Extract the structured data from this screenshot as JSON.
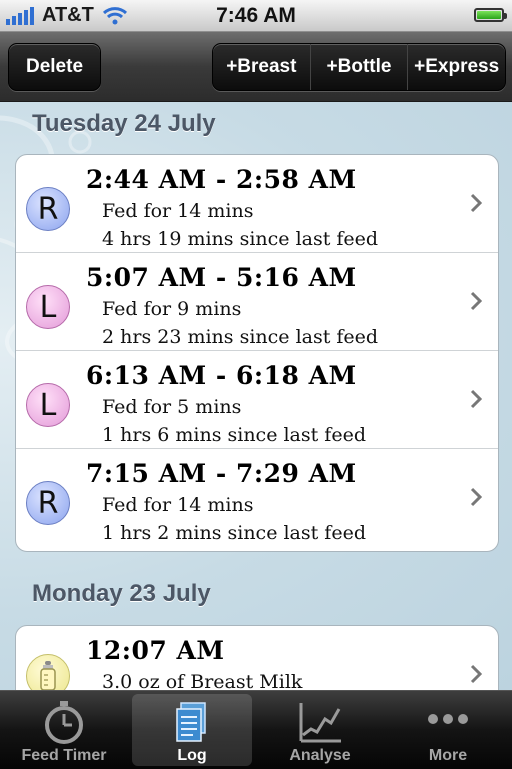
{
  "status": {
    "carrier": "AT&T",
    "time": "7:46 AM"
  },
  "toolbar": {
    "delete": "Delete",
    "add_breast": "+Breast",
    "add_bottle": "+Bottle",
    "add_express": "+Express"
  },
  "sections": [
    {
      "header": "Tuesday 24 July",
      "rows": [
        {
          "side": "R",
          "time": "2:44 AM - 2:58 AM",
          "line1": "Fed for 14 mins",
          "line2": "4 hrs 19 mins since last feed"
        },
        {
          "side": "L",
          "time": "5:07 AM - 5:16 AM",
          "line1": "Fed for 9 mins",
          "line2": "2 hrs 23 mins since last feed"
        },
        {
          "side": "L",
          "time": "6:13 AM - 6:18 AM",
          "line1": "Fed for 5 mins",
          "line2": "1 hrs 6 mins since last feed"
        },
        {
          "side": "R",
          "time": "7:15 AM - 7:29 AM",
          "line1": "Fed for 14 mins",
          "line2": "1 hrs 2 mins since last feed"
        }
      ]
    },
    {
      "header": "Monday 23 July",
      "rows": [
        {
          "side": "bottle",
          "time": "12:07 AM",
          "line1": "3.0 oz of Breast Milk",
          "line2": ""
        }
      ]
    }
  ],
  "tabs": [
    {
      "label": "Feed Timer",
      "icon": "stopwatch-icon"
    },
    {
      "label": "Log",
      "icon": "log-icon",
      "active": true
    },
    {
      "label": "Analyse",
      "icon": "chart-icon"
    },
    {
      "label": "More",
      "icon": "more-icon"
    }
  ],
  "colors": {
    "right_badge": "#8ca4ee",
    "left_badge": "#e39ad8",
    "bottle_badge": "#ece68c",
    "section_text": "#4c5766"
  }
}
